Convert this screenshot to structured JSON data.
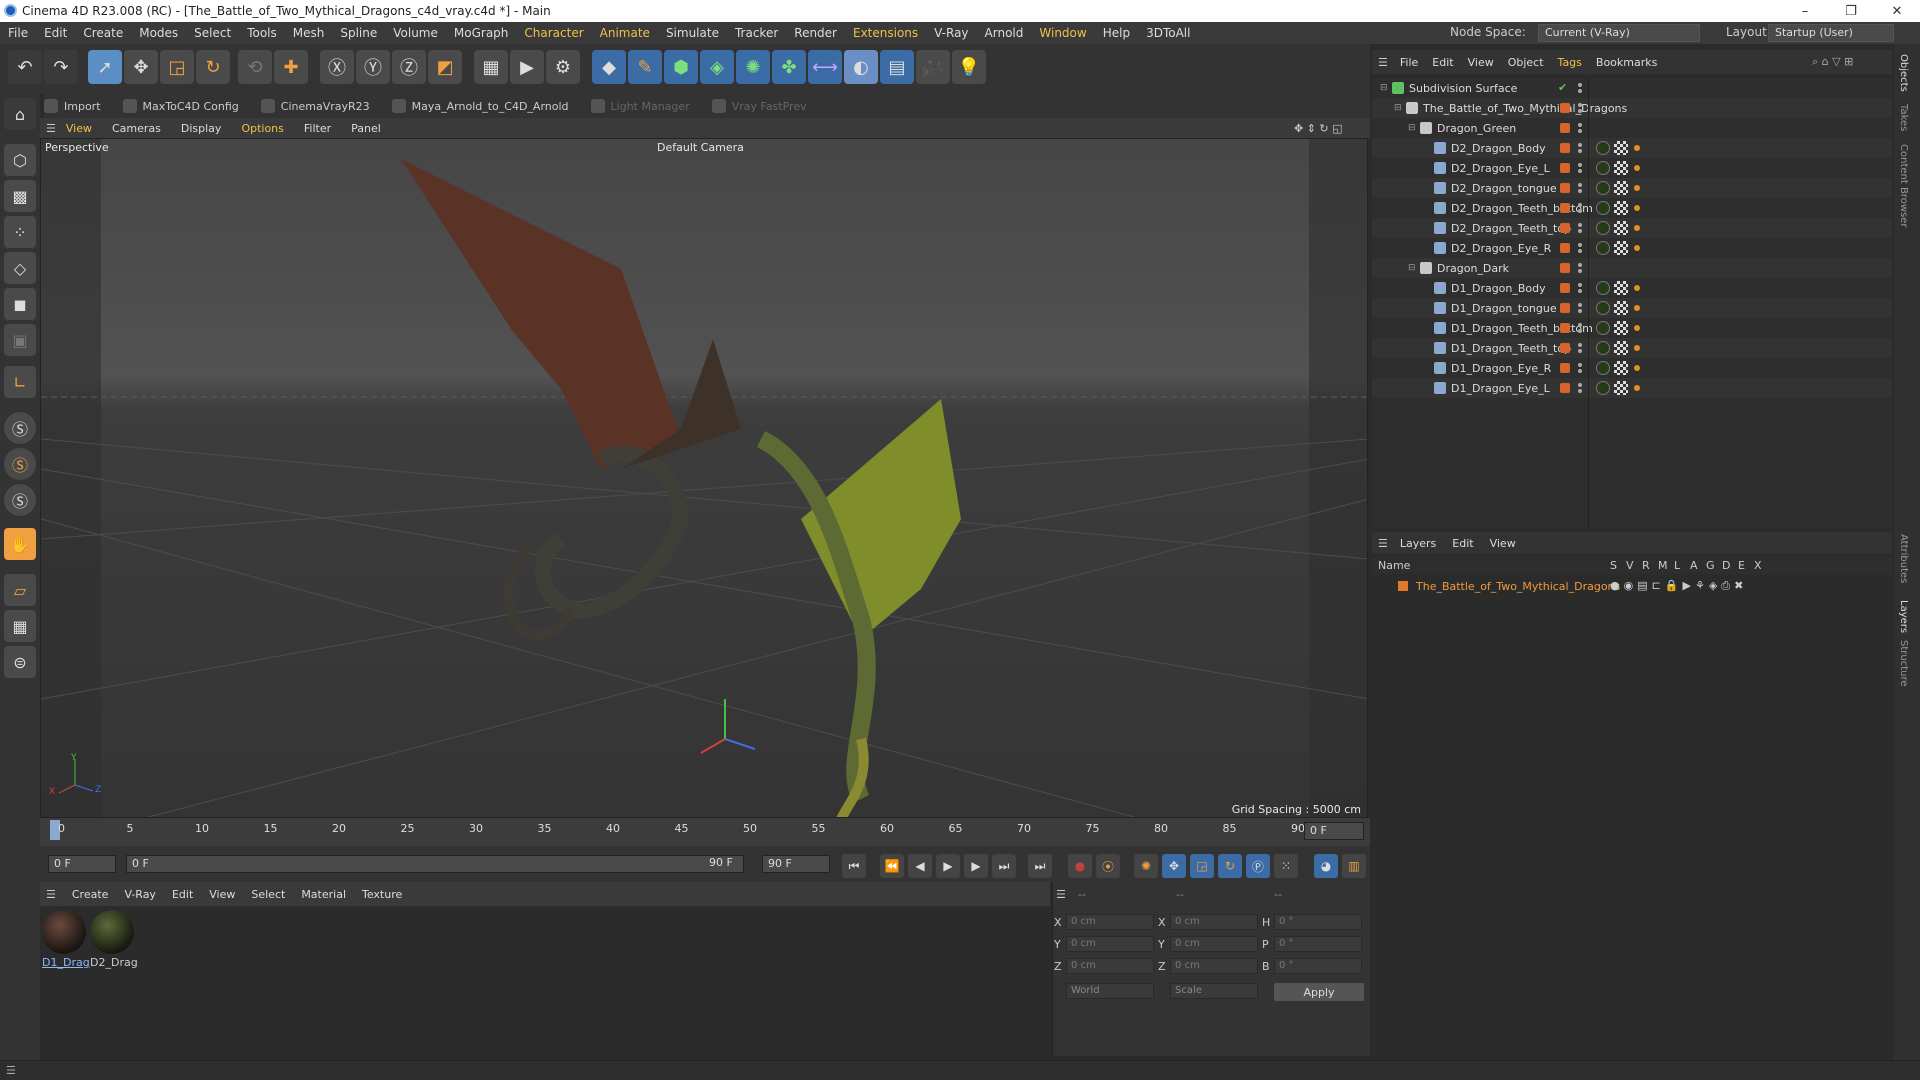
{
  "window": {
    "title": "Cinema 4D R23.008 (RC) - [The_Battle_of_Two_Mythical_Dragons_c4d_vray.c4d *] - Main",
    "min": "–",
    "max": "❐",
    "close": "✕"
  },
  "menu": [
    "File",
    "Edit",
    "Create",
    "Modes",
    "Select",
    "Tools",
    "Mesh",
    "Spline",
    "Volume",
    "MoGraph",
    "Character",
    "Animate",
    "Simulate",
    "Tracker",
    "Render",
    "Extensions",
    "V-Ray",
    "Arnold",
    "Window",
    "Help",
    "3DToAll"
  ],
  "nodespace": {
    "label": "Node Space:",
    "value": "Current (V-Ray)"
  },
  "layout": {
    "label": "Layout:",
    "value": "Startup (User)"
  },
  "subtoolbar": [
    {
      "label": "Import",
      "dim": false
    },
    {
      "label": "MaxToC4D Config",
      "dim": false
    },
    {
      "label": "CinemaVrayR23",
      "dim": false
    },
    {
      "label": "Maya_Arnold_to_C4D_Arnold",
      "dim": false
    },
    {
      "label": "Light Manager",
      "dim": true
    },
    {
      "label": "Vray FastPrev",
      "dim": true
    }
  ],
  "viewport": {
    "menu": [
      "View",
      "Cameras",
      "Display",
      "Options",
      "Filter",
      "Panel"
    ],
    "label": "Perspective",
    "camera": "Default Camera",
    "grid": "Grid Spacing : 5000 cm",
    "axis_y": "Y",
    "axis_x": "X",
    "axis_z": "Z"
  },
  "timeline": {
    "ticks": [
      "0",
      "5",
      "10",
      "15",
      "20",
      "25",
      "30",
      "35",
      "40",
      "45",
      "50",
      "55",
      "60",
      "65",
      "70",
      "75",
      "80",
      "85",
      "90"
    ],
    "current": "0 F"
  },
  "transport": {
    "start": "0 F",
    "range_start": "0 F",
    "range_end": "90 F",
    "end": "90 F"
  },
  "material": {
    "menu": [
      "Create",
      "V-Ray",
      "Edit",
      "View",
      "Select",
      "Material",
      "Texture"
    ],
    "items": [
      {
        "label": "D1_Drag"
      },
      {
        "label": "D2_Drag"
      }
    ]
  },
  "coords": {
    "header": [
      "--",
      "--",
      "--"
    ],
    "rows": [
      {
        "a": "X",
        "av": "0 cm",
        "b": "X",
        "bv": "0 cm",
        "c": "H",
        "cv": "0 °"
      },
      {
        "a": "Y",
        "av": "0 cm",
        "b": "Y",
        "bv": "0 cm",
        "c": "P",
        "cv": "0 °"
      },
      {
        "a": "Z",
        "av": "0 cm",
        "b": "Z",
        "bv": "0 cm",
        "c": "B",
        "cv": "0 °"
      }
    ],
    "space": "World",
    "mode": "Scale",
    "apply": "Apply"
  },
  "objects": {
    "menu": [
      "File",
      "Edit",
      "View",
      "Object",
      "Tags",
      "Bookmarks"
    ],
    "tree": [
      {
        "name": "Subdivision Surface",
        "level": 0,
        "kind": "subd",
        "tags": false
      },
      {
        "name": "The_Battle_of_Two_Mythical_Dragons",
        "level": 1,
        "kind": "null",
        "tags": false
      },
      {
        "name": "Dragon_Green",
        "level": 2,
        "kind": "null",
        "tags": false
      },
      {
        "name": "D2_Dragon_Body",
        "level": 3,
        "kind": "mesh",
        "tags": true
      },
      {
        "name": "D2_Dragon_Eye_L",
        "level": 3,
        "kind": "mesh",
        "tags": true
      },
      {
        "name": "D2_Dragon_tongue",
        "level": 3,
        "kind": "mesh",
        "tags": true
      },
      {
        "name": "D2_Dragon_Teeth_bottom",
        "level": 3,
        "kind": "mesh",
        "tags": true
      },
      {
        "name": "D2_Dragon_Teeth_top",
        "level": 3,
        "kind": "mesh",
        "tags": true
      },
      {
        "name": "D2_Dragon_Eye_R",
        "level": 3,
        "kind": "mesh",
        "tags": true
      },
      {
        "name": "Dragon_Dark",
        "level": 2,
        "kind": "null",
        "tags": false
      },
      {
        "name": "D1_Dragon_Body",
        "level": 3,
        "kind": "mesh",
        "tags": true
      },
      {
        "name": "D1_Dragon_tongue",
        "level": 3,
        "kind": "mesh",
        "tags": true
      },
      {
        "name": "D1_Dragon_Teeth_bottom",
        "level": 3,
        "kind": "mesh",
        "tags": true
      },
      {
        "name": "D1_Dragon_Teeth_top",
        "level": 3,
        "kind": "mesh",
        "tags": true
      },
      {
        "name": "D1_Dragon_Eye_R",
        "level": 3,
        "kind": "mesh",
        "tags": true
      },
      {
        "name": "D1_Dragon_Eye_L",
        "level": 3,
        "kind": "mesh",
        "tags": true
      }
    ]
  },
  "layers": {
    "menu": [
      "Layers",
      "Edit",
      "View"
    ],
    "columns": [
      "Name",
      "S",
      "V",
      "R",
      "M",
      "L",
      "A",
      "G",
      "D",
      "E",
      "X"
    ],
    "items": [
      {
        "name": "The_Battle_of_Two_Mythical_Dragons",
        "color": "#e07a2a"
      }
    ]
  },
  "side_tabs": [
    "Objects",
    "Takes",
    "Content Browser",
    "Attributes",
    "Layers",
    "Structure"
  ],
  "colors": {
    "accent": "#f0c14a",
    "object_color": "#d9642b",
    "layer_text": "#f09a3a"
  }
}
